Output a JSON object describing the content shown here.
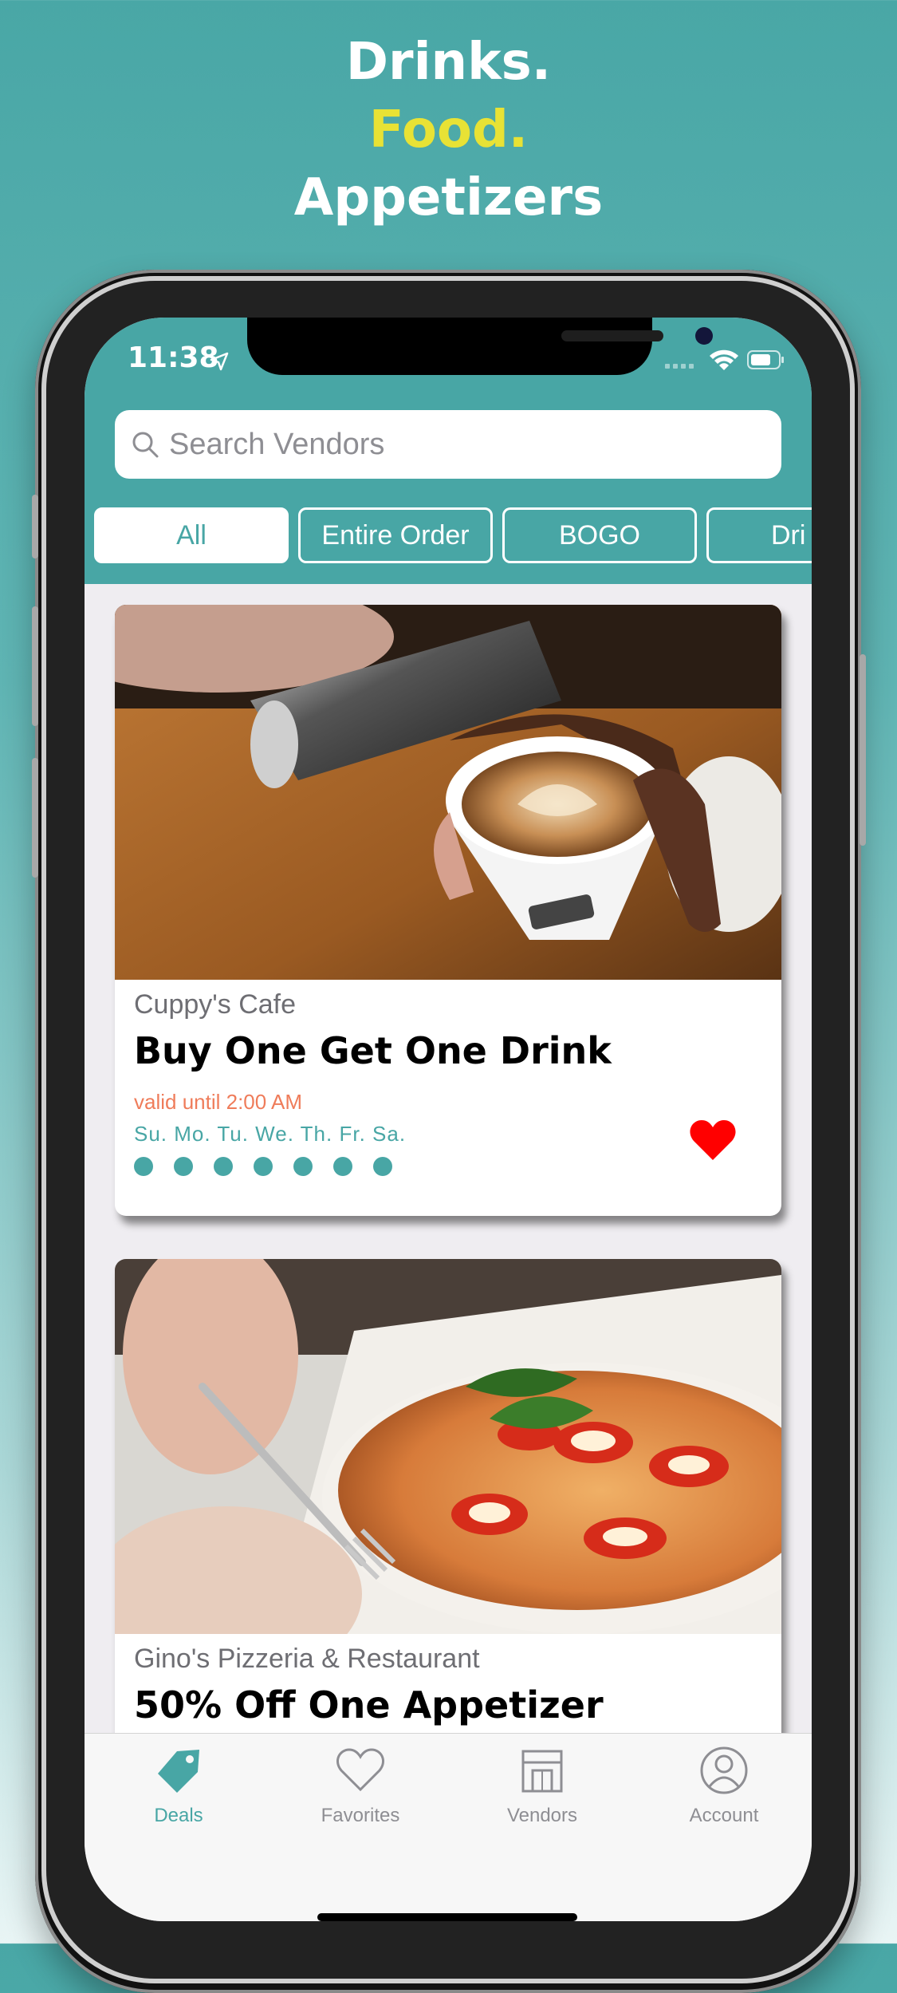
{
  "promo": {
    "line1": "Drinks.",
    "line2": "Food.",
    "line3": "Appetizers"
  },
  "status_bar": {
    "time": "11:38"
  },
  "search": {
    "placeholder": "Search Vendors"
  },
  "filters": [
    "All",
    "Entire Order",
    "BOGO",
    "Dri"
  ],
  "deals": [
    {
      "vendor": "Cuppy's Cafe",
      "title": "Buy One Get One Drink",
      "valid": "valid until 2:00 AM",
      "days": "Su. Mo. Tu. We. Th. Fr. Sa.",
      "active_days": 7,
      "favorite": true
    },
    {
      "vendor": "Gino's Pizzeria & Restaurant",
      "title": "50% Off One Appetizer"
    }
  ],
  "tabs": [
    {
      "label": "Deals",
      "icon": "tag-icon"
    },
    {
      "label": "Favorites",
      "icon": "heart-outline-icon"
    },
    {
      "label": "Vendors",
      "icon": "storefront-icon"
    },
    {
      "label": "Account",
      "icon": "person-circle-icon"
    }
  ],
  "colors": {
    "accent": "#48a6a5",
    "headline_yellow": "#e8e235",
    "valid_text": "#ef7c5a",
    "heart": "#ff0000"
  }
}
